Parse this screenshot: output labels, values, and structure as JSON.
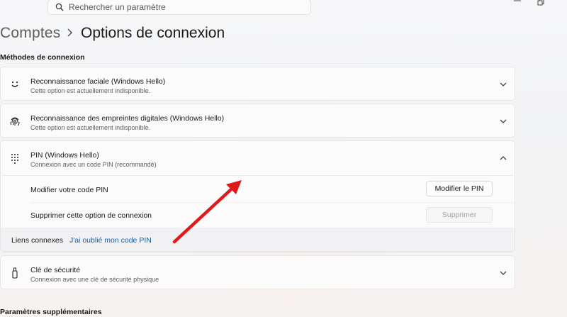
{
  "search": {
    "placeholder": "Rechercher un paramètre"
  },
  "window_controls": [
    "minimize-icon",
    "restore-icon"
  ],
  "breadcrumb": {
    "parent": "Comptes",
    "separator": "chevron-right-icon",
    "title": "Options de connexion"
  },
  "sections": {
    "methods_label": "Méthodes de connexion",
    "additional_label": "Paramètres supplémentaires"
  },
  "methods": [
    {
      "icon": "smiley-face-icon",
      "title": "Reconnaissance faciale (Windows Hello)",
      "subtitle": "Cette option est actuellement indisponible.",
      "expanded": false
    },
    {
      "icon": "fingerprint-icon",
      "title": "Reconnaissance des empreintes digitales (Windows Hello)",
      "subtitle": "Cette option est actuellement indisponible.",
      "expanded": false
    },
    {
      "icon": "pin-keypad-icon",
      "title": "PIN (Windows Hello)",
      "subtitle": "Connexion avec un code PIN (recommandé)",
      "expanded": true
    },
    {
      "icon": "security-key-icon",
      "title": "Clé de sécurité",
      "subtitle": "Connexion avec une clé de sécurité physique",
      "expanded": false
    }
  ],
  "pin": {
    "change_label": "Modifier votre code PIN",
    "change_button": "Modifier le PIN",
    "remove_label": "Supprimer cette option de connexion",
    "remove_button": "Supprimer",
    "related_label": "Liens connexes",
    "forgot_link": "J'ai oublié mon code PIN"
  },
  "colors": {
    "link": "#0f5fa8",
    "annotation_arrow": "#e0191b"
  }
}
